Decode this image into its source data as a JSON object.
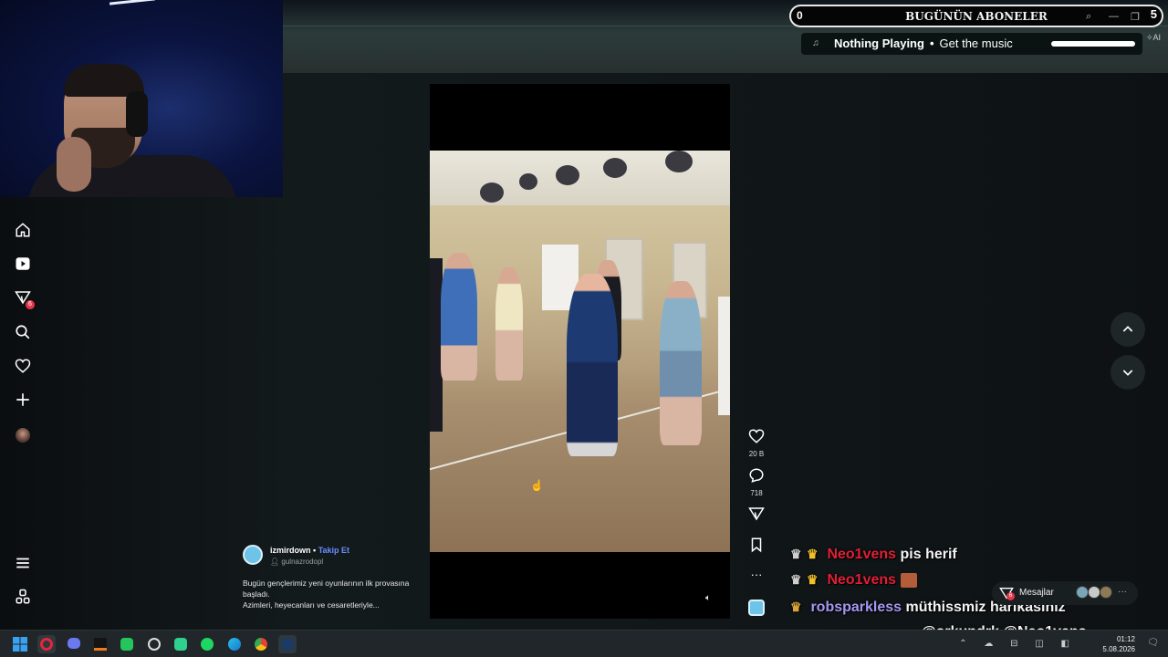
{
  "alert_bar": {
    "count": "0",
    "title": "BUGÜNÜN ABONELER",
    "right_value": "5"
  },
  "music": {
    "now_playing": "Nothing Playing",
    "cta": "Get the music",
    "ai_label": "AI",
    "progress": 1.0
  },
  "nav": {
    "items": [
      "home-icon",
      "video-icon",
      "inbox-icon",
      "search-icon",
      "heart-icon",
      "plus-icon",
      "avatar"
    ],
    "inbox_badge": "6",
    "menu_icon": "menu-icon",
    "apps_icon": "apps-icon"
  },
  "post": {
    "username": "izmirdown",
    "separator": "•",
    "follow_label": "Takip Et",
    "sub_user": "gulnazrodopl",
    "caption_line1": "Bugün gençlerimiz yeni oyunlarının ilk provasına başladı.",
    "caption_line2": "Azimleri, heyecanları ve cesaretleriyle..."
  },
  "actions": {
    "likes": "20 B",
    "comments": "718"
  },
  "chat": [
    {
      "nick": "Neo1vens",
      "message": "pis herif"
    },
    {
      "nick": "Neo1vens",
      "message": ""
    },
    {
      "nick": "robsparkless",
      "message": "müthissmiz harikasınız"
    },
    {
      "nick": "",
      "message": "@orkundrk @Neo1vens"
    }
  ],
  "mesajlar": {
    "label": "Mesajlar",
    "badge": "6"
  },
  "taskbar": {
    "time": "01:12",
    "date": "5.08.2026"
  },
  "colors": {
    "chat_red": "#e11f36",
    "chat_purple": "#a597f2",
    "follow_blue": "#6a8cff",
    "badge_red": "#e5364a"
  }
}
